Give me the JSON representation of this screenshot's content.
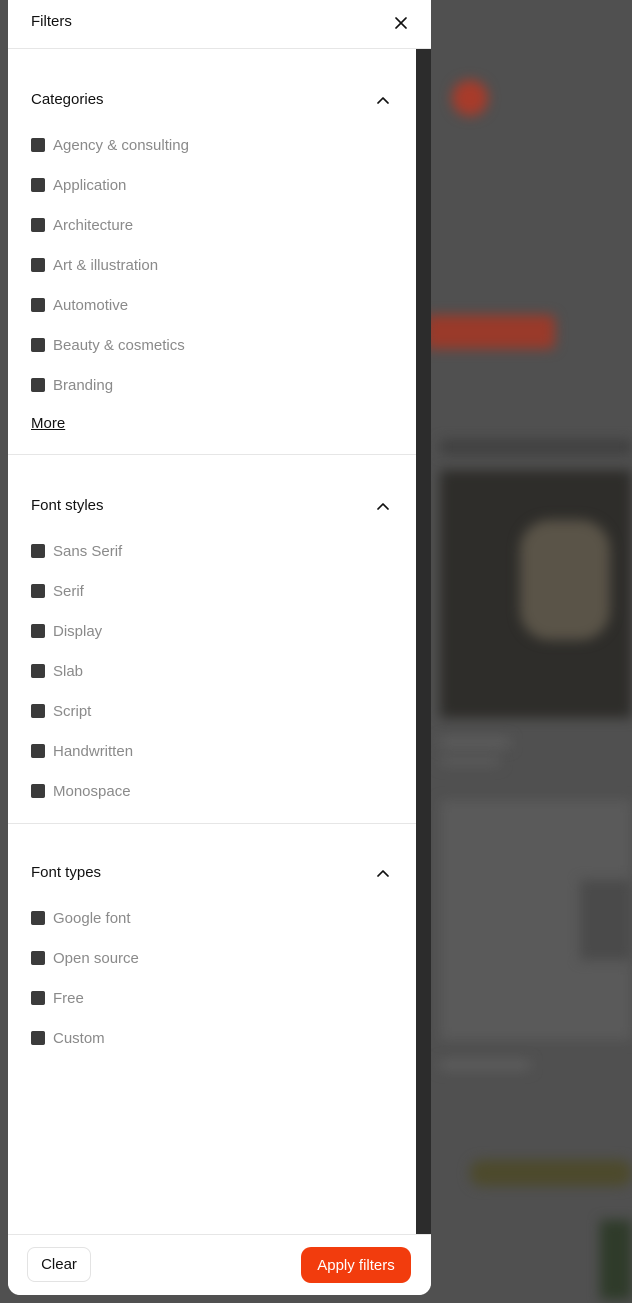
{
  "drawer": {
    "title": "Filters",
    "close_icon": "close-icon"
  },
  "sections": {
    "categories": {
      "title": "Categories",
      "items": [
        "Agency & consulting",
        "Application",
        "Architecture",
        "Art & illustration",
        "Automotive",
        "Beauty & cosmetics",
        "Branding"
      ],
      "more_label": "More"
    },
    "font_styles": {
      "title": "Font styles",
      "items": [
        "Sans Serif",
        "Serif",
        "Display",
        "Slab",
        "Script",
        "Handwritten",
        "Monospace"
      ]
    },
    "font_types": {
      "title": "Font types",
      "items": [
        "Google font",
        "Open source",
        "Free",
        "Custom"
      ]
    }
  },
  "footer": {
    "clear_label": "Clear",
    "apply_label": "Apply filters"
  },
  "colors": {
    "accent": "#f23c0d",
    "checkbox": "#3b3b3b",
    "option_text": "#8a8a8a"
  }
}
